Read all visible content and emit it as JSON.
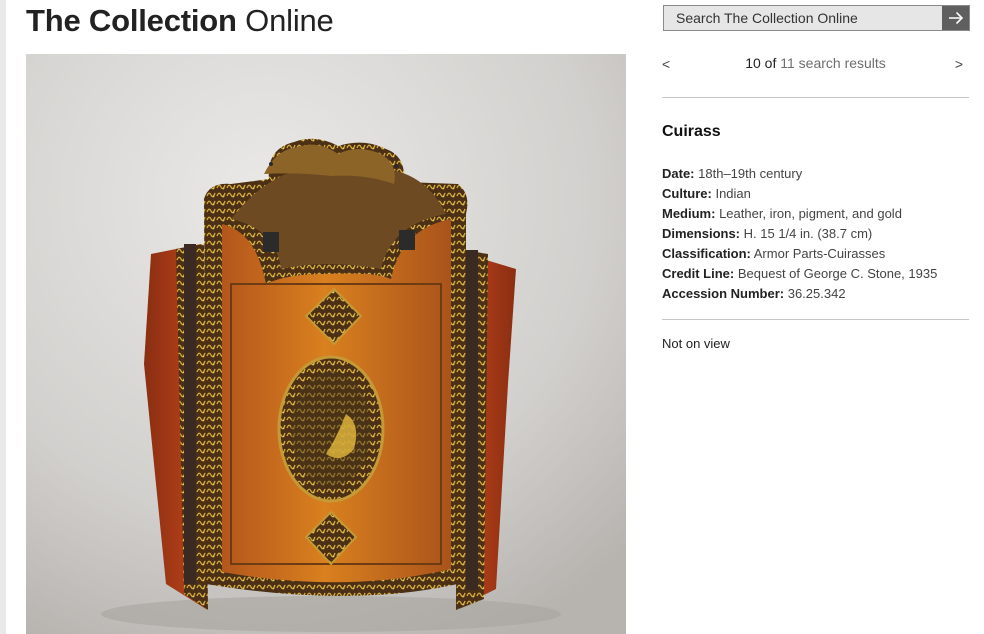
{
  "header": {
    "title_bold": "The Collection",
    "title_light": " Online"
  },
  "search": {
    "placeholder": "Search The Collection Online",
    "submit_icon": "arrow-right-icon"
  },
  "pager": {
    "prev_label": "<",
    "next_label": ">",
    "current": "10",
    "of_label": "of",
    "results_link": "11 search results"
  },
  "object": {
    "title": "Cuirass",
    "fields": [
      {
        "label": "Date:",
        "value": "18th–19th century"
      },
      {
        "label": "Culture:",
        "value": "Indian"
      },
      {
        "label": "Medium:",
        "value": "Leather, iron, pigment, and gold"
      },
      {
        "label": "Dimensions:",
        "value": "H. 15 1/4 in. (38.7 cm)"
      },
      {
        "label": "Classification:",
        "value": "Armor Parts-Cuirasses"
      },
      {
        "label": "Credit Line:",
        "value": "Bequest of George C. Stone, 1935"
      },
      {
        "label": "Accession Number:",
        "value": "36.25.342"
      }
    ],
    "status": "Not on view"
  },
  "colors": {
    "title_text": "#222222",
    "search_bg": "#e6e6e6",
    "search_button": "#5f5f5f",
    "link_gray": "#6e6e6e",
    "divider": "#c4c4c4"
  }
}
